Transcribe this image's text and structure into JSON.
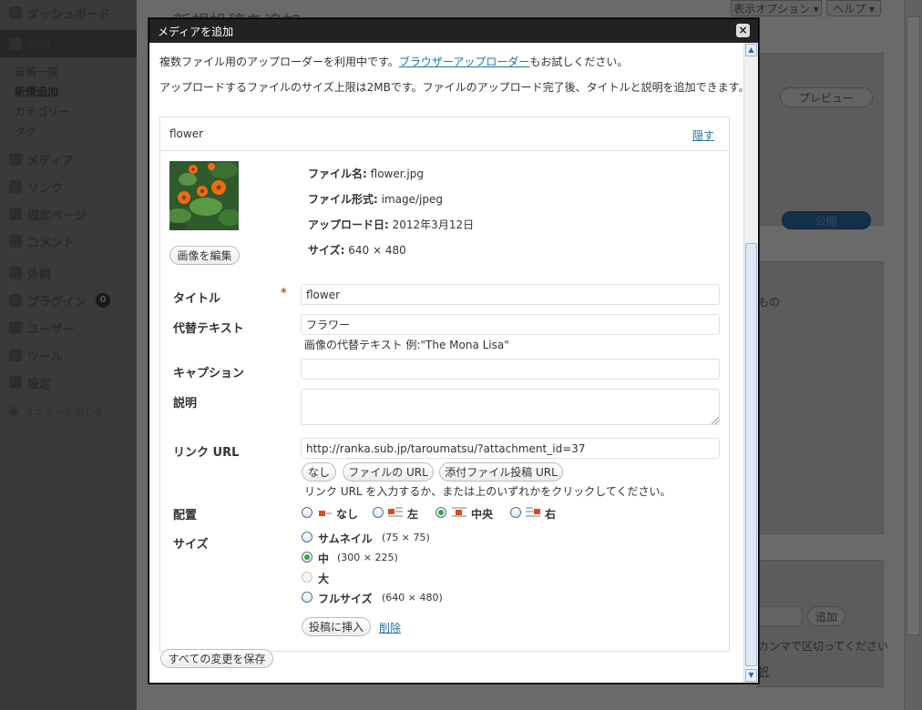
{
  "admin": {
    "menu": {
      "dashboard": "ダッシュボード",
      "posts": "投稿",
      "posts_sub": [
        "投稿一覧",
        "新規追加",
        "カテゴリー",
        "タグ"
      ],
      "media": "メディア",
      "links": "リンク",
      "pages": "固定ページ",
      "comments": "コメント",
      "appearance": "外観",
      "plugins": "プラグイン",
      "plugins_badge": "0",
      "users": "ユーザー",
      "tools": "ツール",
      "settings": "設定",
      "collapse": "メニューを閉じる"
    },
    "page_title": "新規投稿を追加",
    "screen_options": "表示オプション ▾",
    "help": "ヘルプ ▾",
    "preview_button": "プレビュー",
    "publish_button": "公開",
    "tags_add_button": "追加",
    "tags_hint_end": "もの",
    "tags_separator_hint": "カンマで区切ってください",
    "tags_link": "択"
  },
  "modal": {
    "title": "メディアを追加",
    "close": "×",
    "intro_before": "複数ファイル用のアップローダーを利用中です。",
    "intro_link": "ブラウザーアップローダー",
    "intro_after": "もお試しください。",
    "size_notice": "アップロードするファイルのサイズ上限は2MBです。ファイルのアップロード完了後、タイトルと説明を追加できます。",
    "item": {
      "filename_header": "flower",
      "hide_link": "隠す",
      "file_name_label": "ファイル名:",
      "file_name": "flower.jpg",
      "file_type_label": "ファイル形式:",
      "file_type": "image/jpeg",
      "upload_date_label": "アップロード日:",
      "upload_date": "2012年3月12日",
      "dimensions_label": "サイズ:",
      "dimensions": "640 × 480",
      "edit_image_button": "画像を編集"
    },
    "form": {
      "title_label": "タイトル",
      "required_mark": "*",
      "title_value": "flower",
      "alt_label": "代替テキスト",
      "alt_value": "フラワー",
      "alt_help": "画像の代替テキスト 例:\"The Mona Lisa\"",
      "caption_label": "キャプション",
      "caption_value": "",
      "description_label": "説明",
      "description_value": "",
      "link_url_label": "リンク URL",
      "link_url_value": "http://ranka.sub.jp/taroumatsu/?attachment_id=37",
      "link_none_button": "なし",
      "link_file_button": "ファイルの URL",
      "link_post_button": "添付ファイル投稿 URL",
      "link_help": "リンク URL を入力するか、または上のいずれかをクリックしてください。",
      "align_label": "配置",
      "align_options": [
        "なし",
        "左",
        "中央",
        "右"
      ],
      "align_selected": "中央",
      "size_label": "サイズ",
      "size_options": [
        {
          "label": "サムネイル",
          "dims": "(75 × 75)"
        },
        {
          "label": "中",
          "dims": "(300 × 225)"
        },
        {
          "label": "大",
          "dims": ""
        },
        {
          "label": "フルサイズ",
          "dims": "(640 × 480)"
        }
      ],
      "size_selected": "中",
      "insert_button": "投稿に挿入",
      "delete_link": "削除"
    },
    "save_all_button": "すべての変更を保存"
  }
}
